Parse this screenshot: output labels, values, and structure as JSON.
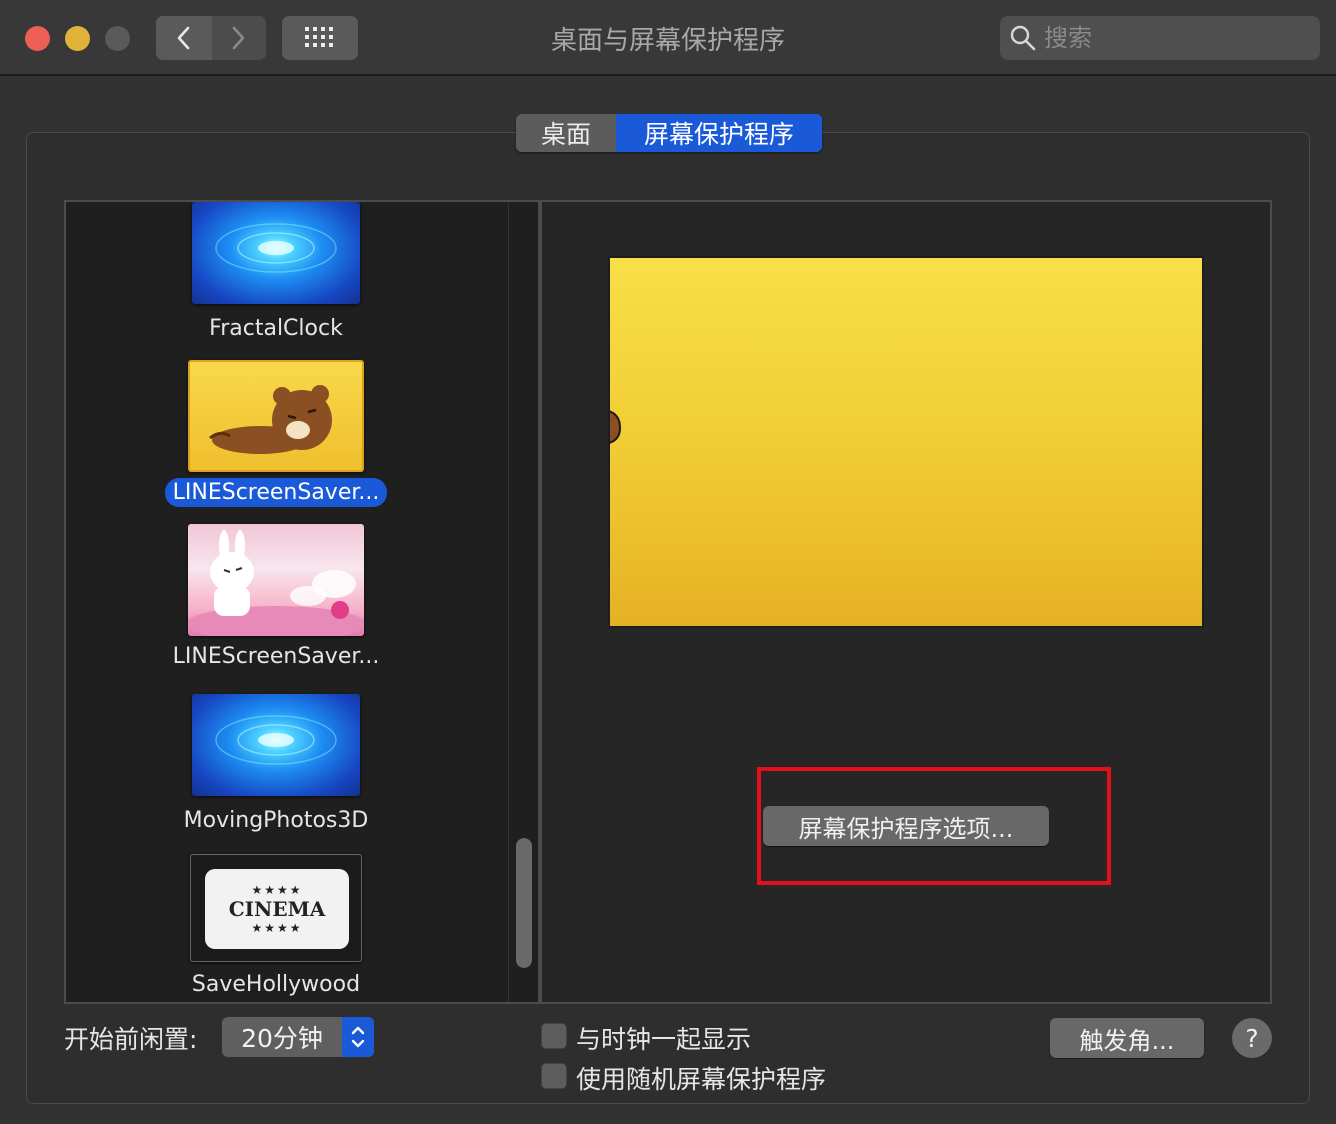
{
  "window": {
    "title": "桌面与屏幕保护程序"
  },
  "search": {
    "placeholder": "搜索"
  },
  "tabs": [
    {
      "label": "桌面",
      "selected": false
    },
    {
      "label": "屏幕保护程序",
      "selected": true
    }
  ],
  "screensavers": [
    {
      "name": "FractalClock",
      "selected": false
    },
    {
      "name": "LINEScreenSaver...",
      "selected": true
    },
    {
      "name": "LINEScreenSaver...",
      "selected": false
    },
    {
      "name": "MovingPhotos3D",
      "selected": false
    },
    {
      "name": "SaveHollywood",
      "selected": false
    }
  ],
  "cinema_thumb": {
    "stars_top": "★★★★",
    "word": "CINEMA",
    "stars_bottom": "★★★★"
  },
  "options_button": "屏幕保护程序选项...",
  "idle": {
    "label": "开始前闲置:",
    "value": "20分钟"
  },
  "checkboxes": [
    {
      "label": "与时钟一起显示",
      "checked": false
    },
    {
      "label": "使用随机屏幕保护程序",
      "checked": false
    }
  ],
  "hot_corners_button": "触发角...",
  "help_button": "?",
  "colors": {
    "accent": "#1a5ad8",
    "highlight_box": "#e3101b"
  }
}
